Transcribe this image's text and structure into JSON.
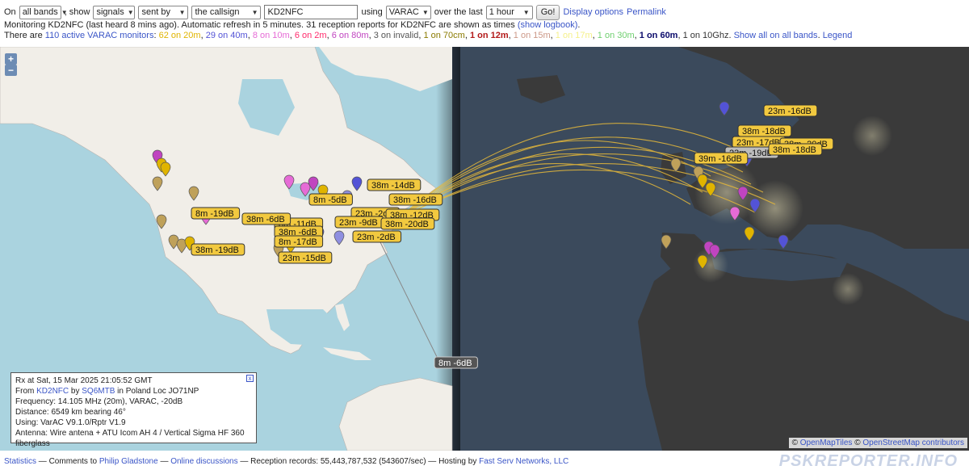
{
  "controls": {
    "on_label": "On",
    "band": "all bands",
    "show_label": ", show",
    "show": "signals",
    "sent_by": "sent by",
    "callsign_mode": "the callsign",
    "callsign": "KD2NFC",
    "using_label": "using",
    "mode": "VARAC",
    "over_label": "over the last",
    "period": "1 hour",
    "go_button": "Go!",
    "display_options": "Display options",
    "permalink": "Permalink"
  },
  "status": {
    "monitoring_text": "Monitoring KD2NFC (last heard 8 mins ago). Automatic refresh in 5 minutes. 31 reception reports for KD2NFC are shown as times",
    "show_logbook": "(show logbook)",
    "period_char": "."
  },
  "monitors": {
    "prefix": "There are",
    "count_link": "110 active VARAC monitors",
    "colon": ":",
    "bands": [
      {
        "text": "62 on 20m",
        "color": "#e0b400"
      },
      {
        "text": "29 on 40m",
        "color": "#5353d6"
      },
      {
        "text": "8 on 10m",
        "color": "#e66bd6"
      },
      {
        "text": "6 on 2m",
        "color": "#ff2a6b"
      },
      {
        "text": "6 on 80m",
        "color": "#c044c0"
      },
      {
        "text": "3 on invalid",
        "color": "#555555"
      },
      {
        "text": "1 on 70cm",
        "color": "#8a7a00"
      },
      {
        "text": "1 on 12m",
        "color": "#b31a1a"
      },
      {
        "text": "1 on 15m",
        "color": "#cc9988"
      },
      {
        "text": "1 on 17m",
        "color": "#f5f08a"
      },
      {
        "text": "1 on 30m",
        "color": "#6fcf6f"
      },
      {
        "text": "1 on 60m",
        "color": "#0b0b6b"
      },
      {
        "text": "1 on 10Ghz",
        "color": "#333333"
      }
    ],
    "show_all": "Show all on all bands",
    "legend": "Legend"
  },
  "map": {
    "zoom_in": "+",
    "zoom_out": "−",
    "labels": [
      "23m -16dB",
      "38m -18dB",
      "23m -17dB",
      "38m -20dB",
      "23m -19dB",
      "38m -18dB",
      "39m -16dB",
      "38m -14dB",
      "8m -5dB",
      "38m -16dB",
      "23m -2dB",
      "38m -12dB",
      "23m -9dB",
      "38m -20dB",
      "23m -2dB",
      "8m -11dB",
      "38m -6dB",
      "38m -6dB",
      "8m -17dB",
      "8m -19dB",
      "38m -19dB",
      "23m -15dB",
      "8m -6dB"
    ],
    "attribution_prefix": "©",
    "attr_link1": "OpenMapTiles",
    "attr_link2": "OpenStreetMap contributors"
  },
  "popup": {
    "line1": "Rx at Sat, 15 Mar 2025 21:05:52 GMT",
    "from_label": "From",
    "from_call": "KD2NFC",
    "by_label": "by",
    "by_call": "SQ6MTB",
    "loc_text": "in Poland Loc JO71NP",
    "line3": "Frequency: 14.105 MHz (20m), VARAC, -20dB",
    "line4": "Distance: 6549 km bearing 46°",
    "line5": "Using: VarAC V9.1.0/Rptr V1.9",
    "line6": "Antenna: Wire antena + ATU Icom AH 4 / Vertical Sigma HF 360 fiberglass",
    "close": "x"
  },
  "footer": {
    "statistics": "Statistics",
    "comments": "— Comments to",
    "philip": "Philip Gladstone",
    "dash1": "—",
    "online": "Online discussions",
    "records": "— Reception records: 55,443,787,532 (543607/sec) — Hosting by",
    "hosting": "Fast Serv Networks, LLC",
    "brand": "PSKREPORTER.INFO"
  },
  "colors": {
    "label_fill": "#f2c93f",
    "day_land": "#f1eee8",
    "night_land": "#3a3a3a",
    "ocean_day": "#aad3df",
    "ocean_night": "#3b4a5c"
  }
}
